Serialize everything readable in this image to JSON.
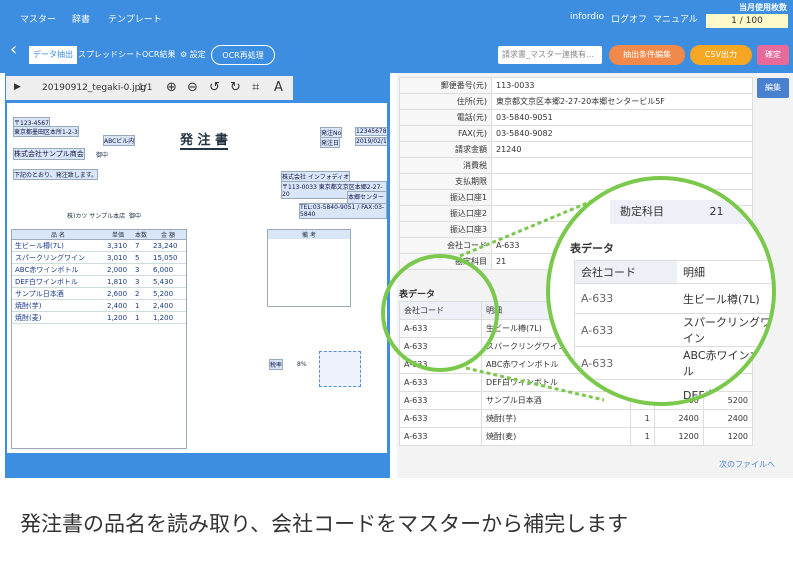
{
  "topbar": {
    "nav": [
      "マスター",
      "辞書",
      "テンプレート"
    ],
    "user": "infordio",
    "logout": "ログオフ",
    "manual": "マニュアル",
    "usage_label": "当月使用枚数",
    "usage_value": "1 / 100"
  },
  "toolbar": {
    "back": "‹",
    "data_extract": "データ抽出",
    "spreadsheet": "スプレッドシート",
    "ocr_result": "OCR結果",
    "settings": "設定",
    "ocr_rerun": "OCR再処理",
    "select": "請求書_マスター連携有…",
    "extract_edit": "抽出条件編集",
    "csv": "CSV出力",
    "confirm": "確定"
  },
  "viewer": {
    "filename": "20190912_tegaki-0.jpg",
    "page": "1/1"
  },
  "doc": {
    "title": "発 注 書",
    "zip": "〒123-4567",
    "addr": "東京都墨田区本所1-2-3",
    "co_title": "ABCビル内",
    "company": "株式会社サンプル商会",
    "sama": "御中",
    "note": "下記のとおり、発注致します。",
    "order_no": "発注No",
    "order_date": "発注日",
    "order_no_val": "12345678",
    "order_date_val": "2019/02/1",
    "vendor": "株式会社 インフォディオ",
    "vendor_addr": "〒113-0033 東京都文京区本郷2-27-20",
    "vendor_bldg": "本郷センタービ",
    "tel": "TEL:03-5840-9051 / FAX:03-5840",
    "dest": "株)カツ サンプル本店",
    "dest_s": "御中",
    "col_name": "品 名",
    "col_price": "単価",
    "col_qty": "本数",
    "col_amt": "金 額",
    "col_note": "備 考",
    "rows": [
      [
        "生ビール樽(7L)",
        "3,310",
        "7",
        "23,240"
      ],
      [
        "スパークリングワイン",
        "3,010",
        "5",
        "15,050"
      ],
      [
        "ABC赤ワインボトル",
        "2,000",
        "3",
        "6,000"
      ],
      [
        "DEF白ワインボトル",
        "1,810",
        "3",
        "5,430"
      ],
      [
        "サンプル日本酒",
        "2,600",
        "2",
        "5,200"
      ],
      [
        "焼酎(芋)",
        "2,400",
        "1",
        "2,400"
      ],
      [
        "焼酎(麦)",
        "1,200",
        "1",
        "1,200"
      ]
    ],
    "tax": "税率",
    "tax_val": "8%"
  },
  "form": {
    "rows": [
      [
        "郵便番号(元)",
        "113-0033"
      ],
      [
        "住所(元)",
        "東京都文京区本郷2-27-20本郷センタービル5F"
      ],
      [
        "電話(元)",
        "03-5840-9051"
      ],
      [
        "FAX(元)",
        "03-5840-9082"
      ],
      [
        "請求金額",
        "21240"
      ],
      [
        "消費税",
        ""
      ],
      [
        "支払期限",
        ""
      ],
      [
        "振込口座1",
        ""
      ],
      [
        "振込口座2",
        ""
      ],
      [
        "振込口座3",
        ""
      ],
      [
        "会社コード",
        "A-633"
      ],
      [
        "勘定科目",
        "21"
      ]
    ],
    "edit": "編集"
  },
  "table": {
    "title": "表データ",
    "headers": [
      "会社コード",
      "明細"
    ],
    "rows": [
      [
        "A-633",
        "生ビール樽(7L)",
        "",
        ""
      ],
      [
        "A-633",
        "スパークリングワイン",
        "",
        ""
      ],
      [
        "A-633",
        "ABC赤ワインボトル",
        "",
        ""
      ],
      [
        "A-633",
        "DEF白ワインボトル",
        "",
        "5430"
      ],
      [
        "A-633",
        "サンプル日本酒",
        "2",
        "2600",
        "5200"
      ],
      [
        "A-633",
        "焼酎(芋)",
        "1",
        "2400",
        "2400"
      ],
      [
        "A-633",
        "焼酎(麦)",
        "1",
        "1200",
        "1200"
      ]
    ],
    "next": "次のファイルへ"
  },
  "zoom": {
    "kanjo": "勘定科目",
    "kanjo_val": "21",
    "title": "表データ",
    "h1": "会社コード",
    "h2": "明細",
    "rows": [
      [
        "A-633",
        "生ビール樽(7L)"
      ],
      [
        "A-633",
        "スパークリングワイン"
      ],
      [
        "A-633",
        "ABC赤ワインボトル"
      ],
      [
        "A-633",
        "DEF白ワイン"
      ]
    ],
    "extra1": "00",
    "extra2": "5430"
  },
  "caption": "発注書の品名を読み取り、会社コードをマスターから補完します"
}
